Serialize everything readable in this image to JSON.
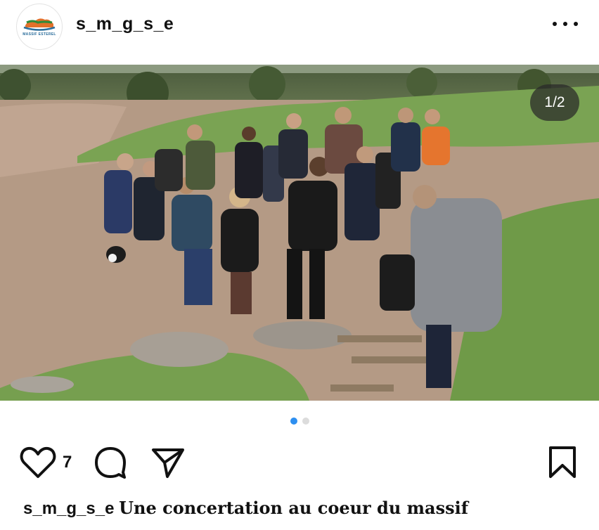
{
  "post": {
    "username": "s_m_g_s_e",
    "avatar_logo_text": "MASSIF ESTEREL",
    "more_icon": "more-horizontal-icon",
    "image_counter": "1/2",
    "carousel": {
      "total": 2,
      "active_index": 0
    },
    "likes_count": "7",
    "caption": {
      "username": "s_m_g_s_e",
      "text": "Une concertation au coeur du massif"
    },
    "actions": {
      "like_icon": "heart-icon",
      "comment_icon": "comment-icon",
      "share_icon": "send-icon",
      "save_icon": "bookmark-icon"
    }
  },
  "colors": {
    "accent": "#2d8ff0",
    "text": "#111111",
    "dot_inactive": "#dcdcdc"
  }
}
